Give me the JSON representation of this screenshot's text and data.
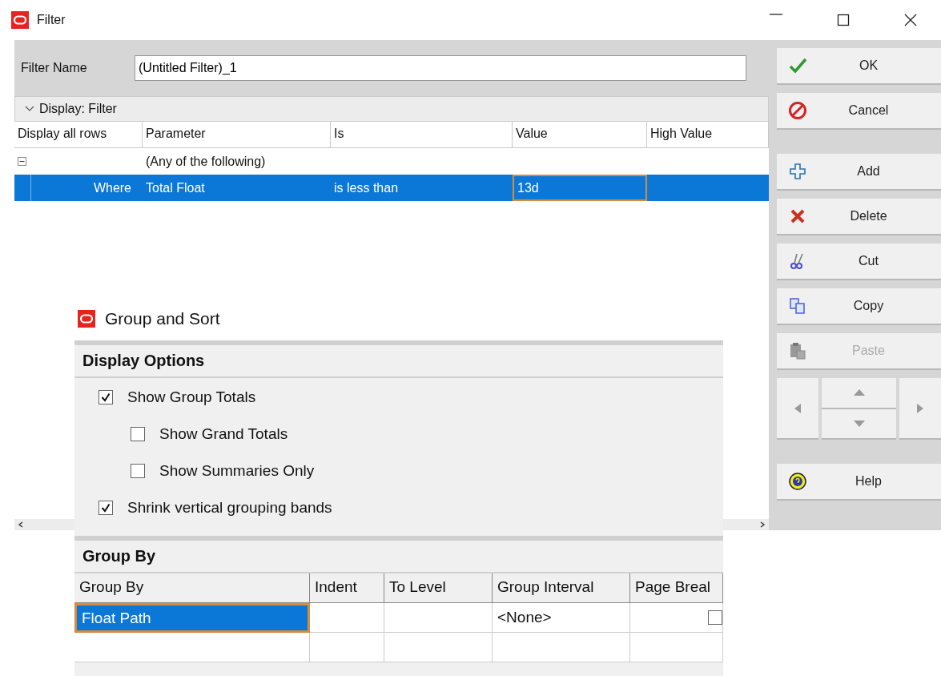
{
  "filter_window": {
    "title": "Filter",
    "filter_name": {
      "label": "Filter Name",
      "value": "(Untitled Filter)_1"
    },
    "section": {
      "label": "Display: Filter",
      "expanded": true
    },
    "columns": [
      "Display all rows",
      "Parameter",
      "Is",
      "Value",
      "High Value"
    ],
    "rows": [
      {
        "kind": "group",
        "label": "(Any of the following)",
        "expanded": true,
        "selected": false
      },
      {
        "kind": "condition",
        "prefix": "Where",
        "parameter": "Total Float",
        "is": "is less than",
        "value": "13d",
        "value_focused": true,
        "selected": true
      }
    ],
    "buttons": [
      {
        "label": "OK",
        "disabled": false,
        "gap_after": false
      },
      {
        "label": "Cancel",
        "disabled": false,
        "gap_after": true
      },
      {
        "label": "Add",
        "disabled": false,
        "gap_after": false
      },
      {
        "label": "Delete",
        "disabled": false,
        "gap_after": false
      },
      {
        "label": "Cut",
        "disabled": false,
        "gap_after": false
      },
      {
        "label": "Copy",
        "disabled": false,
        "gap_after": false
      },
      {
        "label": "Paste",
        "disabled": true,
        "gap_after": false
      }
    ],
    "help_button": {
      "label": "Help"
    }
  },
  "group_sort_window": {
    "title": "Group and Sort",
    "display_options": {
      "heading": "Display Options",
      "options": [
        {
          "label": "Show Group Totals",
          "checked": true,
          "children": [
            {
              "label": "Show Grand Totals",
              "checked": false
            },
            {
              "label": "Show Summaries Only",
              "checked": false
            }
          ]
        },
        {
          "label": "Shrink vertical grouping bands",
          "checked": true
        }
      ]
    },
    "group_by": {
      "heading": "Group By",
      "columns": [
        "Group By",
        "Indent",
        "To Level",
        "Group Interval",
        "Page Breal"
      ],
      "rows": [
        {
          "group_by": "Float Path",
          "group_interval": "<None>",
          "page_break": false,
          "selected": true
        }
      ]
    }
  }
}
